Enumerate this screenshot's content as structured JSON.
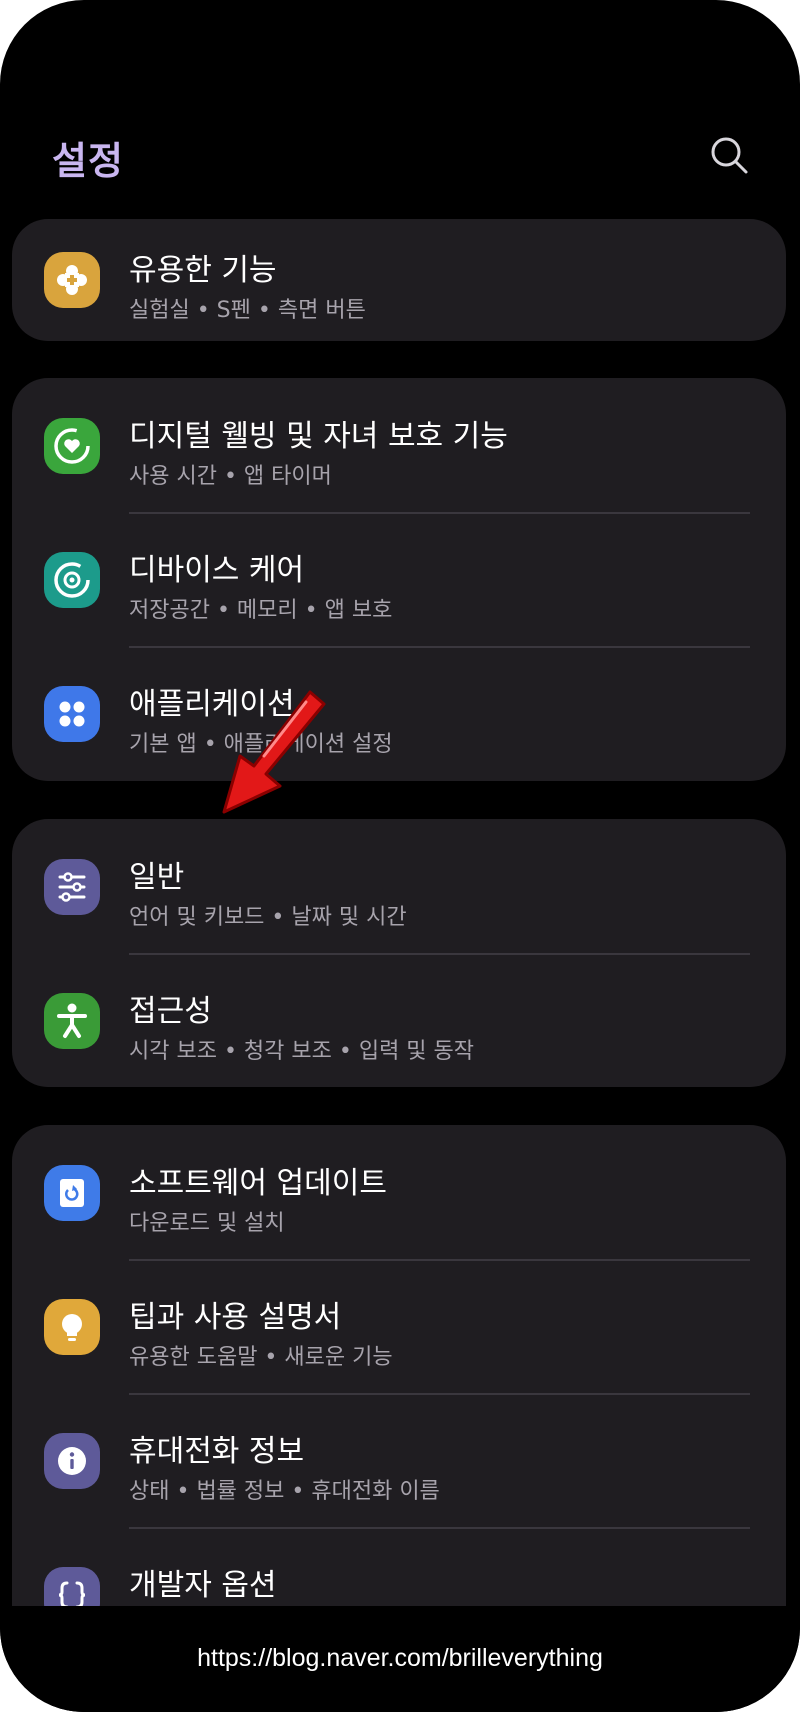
{
  "header": {
    "title": "설정"
  },
  "cards": [
    {
      "items": [
        {
          "title": "유용한 기능",
          "subtitle": "실험실 • S펜 • 측면 버튼",
          "icon": "puzzle-icon",
          "color": "#d9a43d"
        }
      ]
    },
    {
      "items": [
        {
          "title": "디지털 웰빙 및 자녀 보호 기능",
          "subtitle": "사용 시간 • 앱 타이머",
          "icon": "wellbeing-icon",
          "color": "#3aa63c"
        },
        {
          "title": "디바이스 케어",
          "subtitle": "저장공간 • 메모리 • 앱 보호",
          "icon": "device-care-icon",
          "color": "#1c9b8b"
        },
        {
          "title": "애플리케이션",
          "subtitle": "기본 앱 • 애플리케이션 설정",
          "icon": "apps-grid-icon",
          "color": "#3f78e9"
        }
      ]
    },
    {
      "items": [
        {
          "title": "일반",
          "subtitle": "언어 및 키보드 • 날짜 및 시간",
          "icon": "sliders-icon",
          "color": "#5e5a99"
        },
        {
          "title": "접근성",
          "subtitle": "시각 보조 • 청각 보조 • 입력 및 동작",
          "icon": "accessibility-icon",
          "color": "#3a9b37"
        }
      ]
    },
    {
      "items": [
        {
          "title": "소프트웨어 업데이트",
          "subtitle": "다운로드 및 설치",
          "icon": "software-update-icon",
          "color": "#3f7be8"
        },
        {
          "title": "팁과 사용 설명서",
          "subtitle": "유용한 도움말 • 새로운 기능",
          "icon": "lightbulb-icon",
          "color": "#e0a83a"
        },
        {
          "title": "휴대전화 정보",
          "subtitle": "상태 • 법률 정보 • 휴대전화 이름",
          "icon": "info-icon",
          "color": "#5e5a99"
        },
        {
          "title": "개발자 옵션",
          "subtitle": "",
          "icon": "code-braces-icon",
          "color": "#5e5a99"
        }
      ]
    }
  ],
  "footer": {
    "watermark": "https://blog.naver.com/brilleverything"
  },
  "annotation": {
    "icon": "red-arrow-icon",
    "color": "#e21818"
  }
}
